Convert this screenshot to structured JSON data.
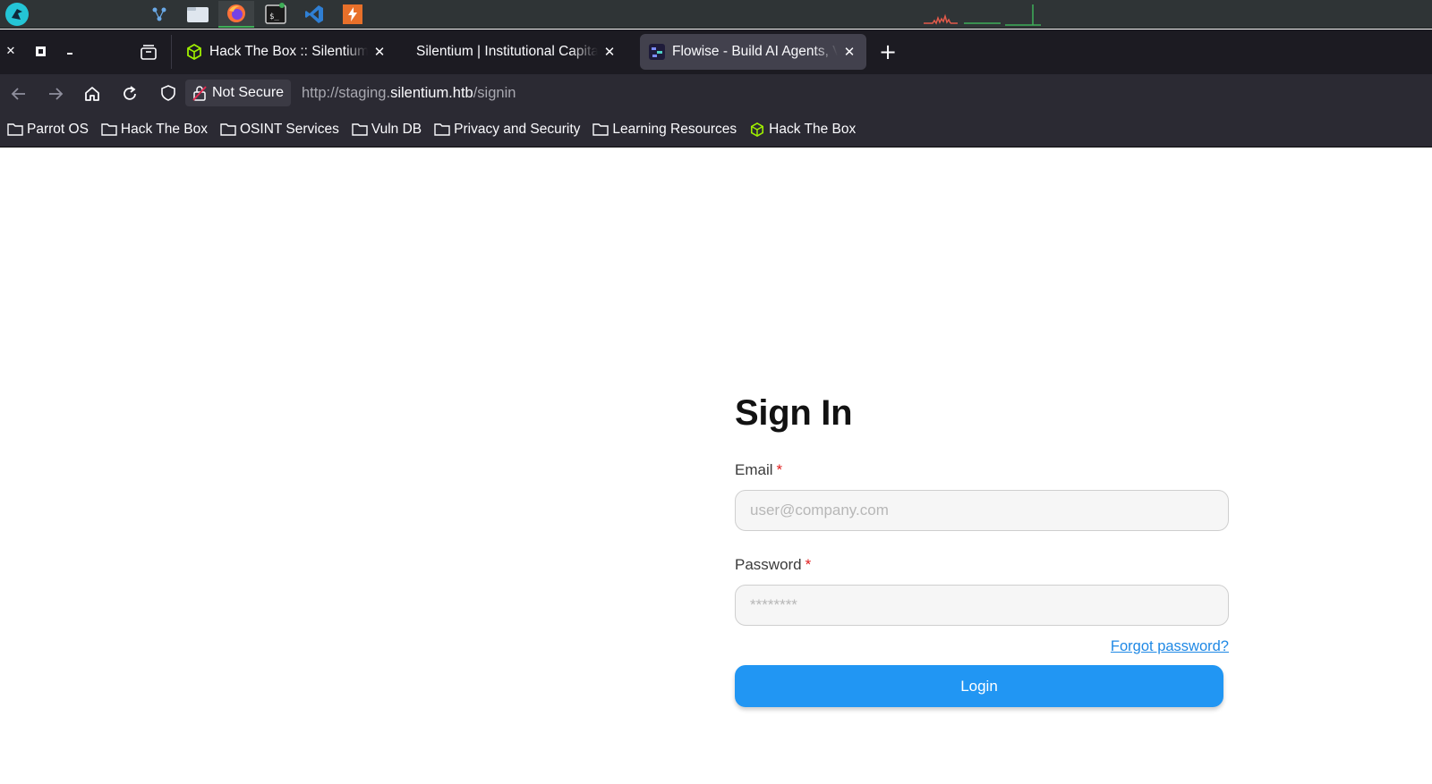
{
  "os_panel": {
    "menu_icon": "parrot-menu-icon",
    "launchers": [
      {
        "name": "network-tool-icon"
      },
      {
        "name": "file-manager-icon"
      },
      {
        "name": "firefox-icon",
        "active": true
      },
      {
        "name": "terminal-icon"
      },
      {
        "name": "vscode-icon"
      },
      {
        "name": "burp-suite-icon"
      }
    ]
  },
  "browser": {
    "tabs": [
      {
        "title": "Hack The Box :: Silentium M",
        "favicon": "htb-cube-icon",
        "selected": false
      },
      {
        "title": "Silentium | Institutional Capital",
        "favicon": "none",
        "selected": false
      },
      {
        "title": "Flowise - Build AI Agents, Visually",
        "favicon": "flowise-icon",
        "selected": true
      }
    ],
    "security_label": "Not Secure",
    "url": {
      "prefix": "http://staging.",
      "host": "silentium.htb",
      "path": "/signin"
    },
    "bookmarks": [
      {
        "label": "Parrot OS",
        "icon": "folder-icon"
      },
      {
        "label": "Hack The Box",
        "icon": "folder-icon"
      },
      {
        "label": "OSINT Services",
        "icon": "folder-icon"
      },
      {
        "label": "Vuln DB",
        "icon": "folder-icon"
      },
      {
        "label": "Privacy and Security",
        "icon": "folder-icon"
      },
      {
        "label": "Learning Resources",
        "icon": "folder-icon"
      },
      {
        "label": "Hack The Box",
        "icon": "htb-cube-icon"
      }
    ]
  },
  "signin": {
    "title": "Sign In",
    "email_label": "Email",
    "email_placeholder": "user@company.com",
    "password_label": "Password",
    "password_placeholder": "********",
    "required_marker": "*",
    "forgot_label": "Forgot password?",
    "login_label": "Login"
  },
  "colors": {
    "accent": "#2196f3",
    "link": "#1e88e5",
    "required": "#e11d1d",
    "browser_chrome": "#2b2a33"
  }
}
